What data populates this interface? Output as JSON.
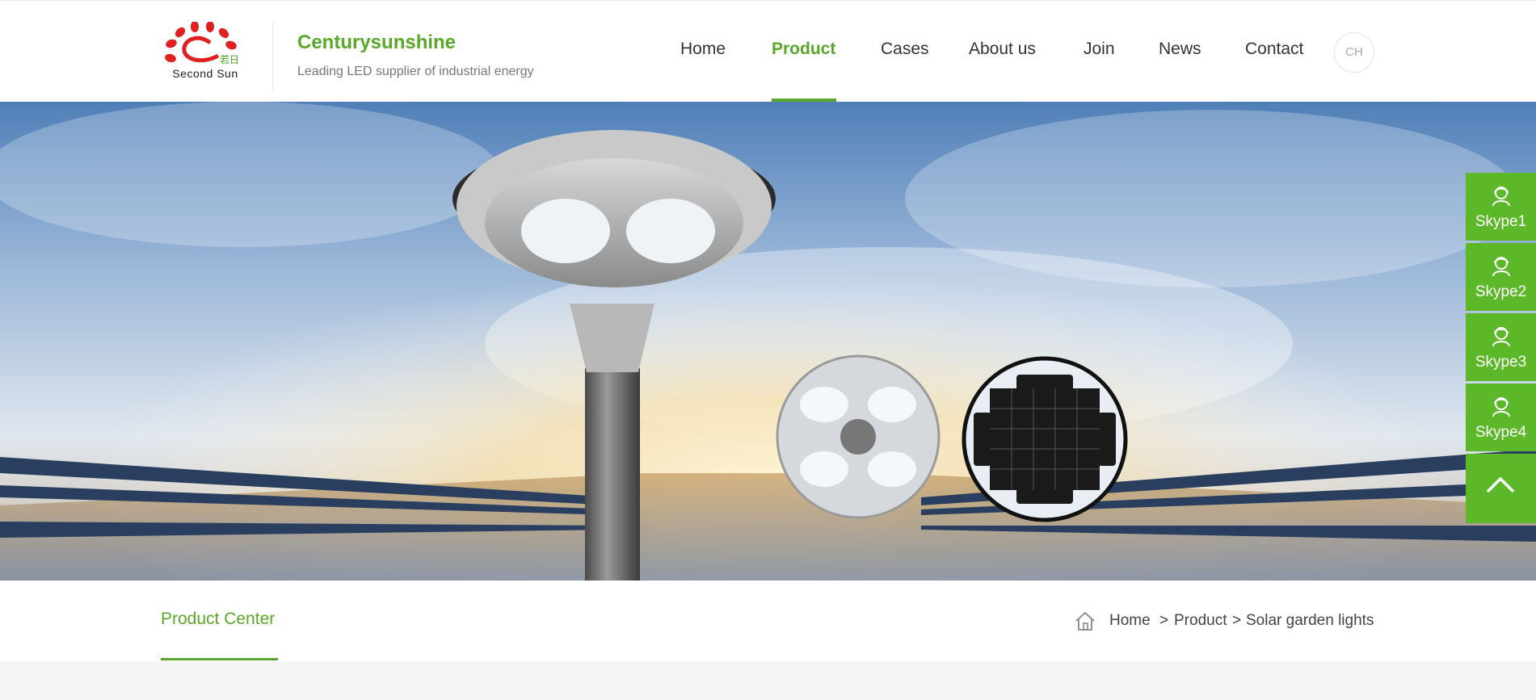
{
  "header": {
    "logo_caption": "Second Sun",
    "logo_cn": "若日",
    "brand_name": "Centurysunshine",
    "brand_tagline": "Leading LED supplier of industrial energy",
    "colors": {
      "accent": "#5aa829",
      "logo_red": "#e02020"
    }
  },
  "nav": {
    "items": [
      {
        "label": "Home",
        "active": false
      },
      {
        "label": "Product",
        "active": true
      },
      {
        "label": "Cases",
        "active": false
      },
      {
        "label": "About us",
        "active": false
      },
      {
        "label": "Join",
        "active": false
      },
      {
        "label": "News",
        "active": false
      },
      {
        "label": "Contact",
        "active": false
      }
    ],
    "lang": "CH"
  },
  "side": {
    "items": [
      {
        "label": "Skype1",
        "icon": "user-support-icon"
      },
      {
        "label": "Skype2",
        "icon": "user-support-icon"
      },
      {
        "label": "Skype3",
        "icon": "user-support-icon"
      },
      {
        "label": "Skype4",
        "icon": "user-support-icon"
      }
    ],
    "top_icon": "chevron-up-icon",
    "color": "#5db829"
  },
  "section": {
    "title": "Product Center"
  },
  "breadcrumb": {
    "home": "Home",
    "sep1": ">",
    "product": "Product",
    "sep2": ">",
    "current": "Solar garden lights"
  }
}
